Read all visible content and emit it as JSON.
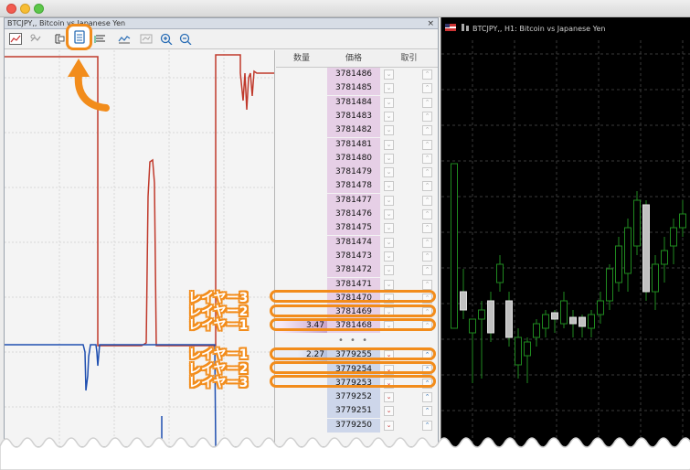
{
  "window": {
    "title": ""
  },
  "left_panel": {
    "title": "BTCJPY,, Bitcoin vs Japanese Yen",
    "close_label": "×",
    "toolbar_icons": [
      "chart-icon",
      "crosshair-icon",
      "auto-scroll-icon",
      "depth-of-market-icon",
      "chart-shift-icon",
      "period-icon",
      "template-icon",
      "zoom-in-icon",
      "zoom-out-icon"
    ],
    "highlight_color": "#f28c1b"
  },
  "dom": {
    "headers": {
      "volume": "数量",
      "price": "価格",
      "trade": "取引"
    },
    "ask_rows": [
      {
        "price": "3781486",
        "volume": ""
      },
      {
        "price": "3781485",
        "volume": ""
      },
      {
        "price": "3781484",
        "volume": ""
      },
      {
        "price": "3781483",
        "volume": ""
      },
      {
        "price": "3781482",
        "volume": ""
      },
      {
        "price": "3781481",
        "volume": ""
      },
      {
        "price": "3781480",
        "volume": ""
      },
      {
        "price": "3781479",
        "volume": ""
      },
      {
        "price": "3781478",
        "volume": ""
      },
      {
        "price": "3781477",
        "volume": ""
      },
      {
        "price": "3781476",
        "volume": ""
      },
      {
        "price": "3781475",
        "volume": ""
      },
      {
        "price": "3781474",
        "volume": ""
      },
      {
        "price": "3781473",
        "volume": ""
      },
      {
        "price": "3781472",
        "volume": ""
      },
      {
        "price": "3781471",
        "volume": ""
      },
      {
        "price": "3781470",
        "volume": ""
      },
      {
        "price": "3781469",
        "volume": ""
      },
      {
        "price": "3781468",
        "volume": "3.47"
      }
    ],
    "separator": "• • •",
    "bid_rows": [
      {
        "price": "3779255",
        "volume": "2.27"
      },
      {
        "price": "3779254",
        "volume": ""
      },
      {
        "price": "3779253",
        "volume": ""
      },
      {
        "price": "3779252",
        "volume": ""
      },
      {
        "price": "3779251",
        "volume": ""
      },
      {
        "price": "3779250",
        "volume": ""
      }
    ]
  },
  "callouts": {
    "ask": [
      "レイヤー3",
      "レイヤー2",
      "レイヤー1"
    ],
    "bid": [
      "レイヤー1",
      "レイヤー2",
      "レイヤー3"
    ]
  },
  "right_chart": {
    "title": "BTCJPY,, H1:  Bitcoin vs Japanese Yen",
    "background": "#000000",
    "bull_color": "#1f8a1f",
    "bear_color": "#c0c0c0"
  },
  "colors": {
    "accent": "#f28c1b",
    "ask_line": "#c0392b",
    "bid_line": "#1f4fb0",
    "ask_price_bg": "#e6cfe6",
    "bid_price_bg": "#cdd6ea"
  }
}
